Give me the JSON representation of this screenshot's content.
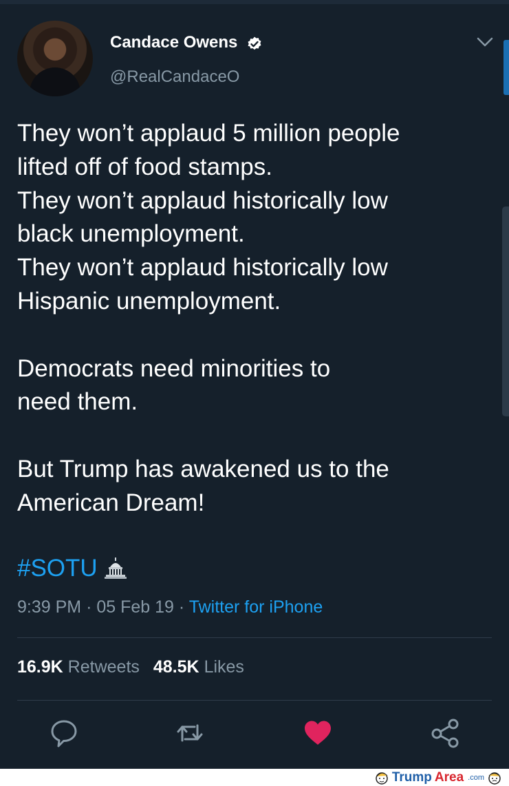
{
  "user": {
    "name": "Candace Owens",
    "handle": "@RealCandaceO",
    "verified": true
  },
  "tweet": {
    "paragraphs": [
      [
        "They won’t applaud 5 million people",
        "lifted off of food stamps.",
        "They won’t applaud historically low",
        "black unemployment.",
        "They won’t applaud historically low",
        "Hispanic unemployment."
      ],
      [
        "Democrats need minorities to",
        "need them."
      ],
      [
        "But Trump has awakened us to the",
        "American Dream!"
      ]
    ],
    "hashtag": "#SOTU",
    "time": "9:39 PM",
    "date": "05 Feb 19",
    "source": "Twitter for iPhone",
    "sep": "·"
  },
  "stats": {
    "retweets_count": "16.9K",
    "retweets_label": "Retweets",
    "likes_count": "48.5K",
    "likes_label": "Likes"
  },
  "icons": {
    "reply": "reply-icon",
    "retweet": "retweet-icon",
    "like": "heart-icon",
    "share": "share-icon",
    "capitol": "capitol-emoji",
    "verified": "verified-badge-icon",
    "menu": "chevron-down-icon"
  },
  "colors": {
    "background": "#15202b",
    "accent": "#1da1f2",
    "muted": "#8899a6",
    "like": "#e0245e"
  },
  "watermark": {
    "brand_part1": "Trump",
    "brand_part2": "Area",
    "brand_suffix": ".com"
  }
}
